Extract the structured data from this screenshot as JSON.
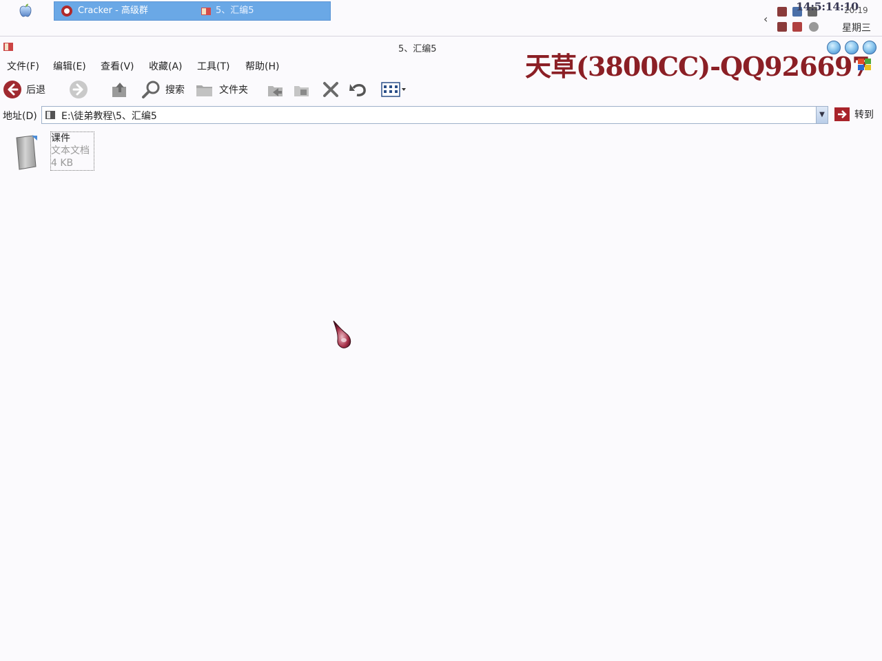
{
  "taskbar": {
    "task1_label": "Cracker - 高级群",
    "task2_label": "5、汇编5",
    "clock_overlay": "14:5:14:10",
    "clock": "20:19",
    "weekday": "星期三"
  },
  "window": {
    "title": "5、汇编5"
  },
  "watermark": "天草(3800CC)-QQ926697",
  "menu": {
    "items": [
      "文件(F)",
      "编辑(E)",
      "查看(V)",
      "收藏(A)",
      "工具(T)",
      "帮助(H)"
    ]
  },
  "toolbar": {
    "back_label": "后退",
    "search_label": "搜索",
    "folders_label": "文件夹"
  },
  "address": {
    "label": "地址(D)",
    "value": "E:\\徒弟教程\\5、汇编5",
    "go_label": "转到"
  },
  "files": [
    {
      "name": "课件",
      "type": "文本文档",
      "size": "4 KB"
    }
  ],
  "colors": {
    "accent_task": "#6aa8e6",
    "watermark": "#8b1f25",
    "back_button": "#a02a30"
  }
}
